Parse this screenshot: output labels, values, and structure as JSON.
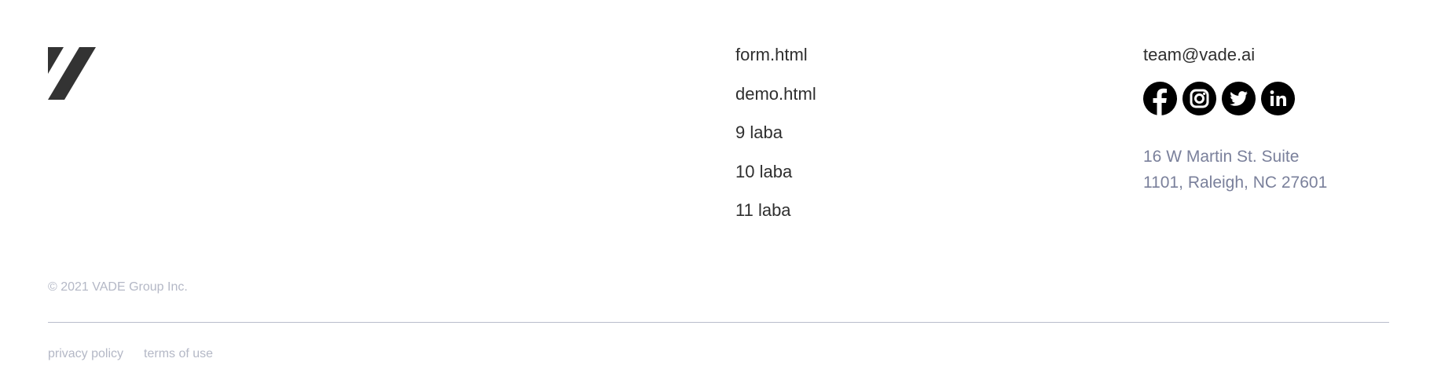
{
  "brand": {
    "logo_icon": "vade-logo-icon",
    "logo_color": "#333333"
  },
  "nav": {
    "links": [
      {
        "label": "form.html"
      },
      {
        "label": "demo.html"
      },
      {
        "label": "9 laba"
      },
      {
        "label": "10 laba"
      },
      {
        "label": "11 laba"
      }
    ]
  },
  "contact": {
    "email": "team@vade.ai",
    "social": [
      {
        "icon": "facebook-icon"
      },
      {
        "icon": "instagram-icon"
      },
      {
        "icon": "twitter-icon"
      },
      {
        "icon": "linkedin-icon"
      }
    ],
    "address_line1": "16 W Martin St. Suite",
    "address_line2": "1101, Raleigh, NC 27601"
  },
  "footer": {
    "copyright": "© 2021 VADE Group Inc.",
    "privacy_label": "privacy policy",
    "terms_label": "terms of use"
  },
  "colors": {
    "text_dark": "#2f2f2f",
    "address_text": "#7a809b",
    "muted_text": "#b4b8c6",
    "divider": "#b8bccb",
    "icon_bg": "#000000"
  }
}
